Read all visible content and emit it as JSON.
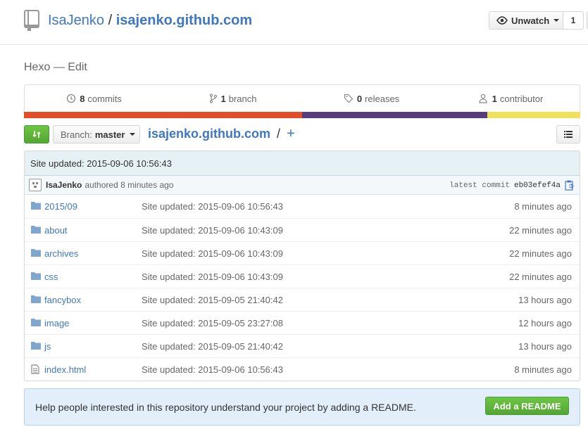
{
  "header": {
    "owner": "IsaJenko",
    "separator": "/",
    "repo": "isajenko.github.com",
    "watch_label": "Unwatch",
    "watch_count": "1"
  },
  "description": {
    "text": "Hexo",
    "dash": "—",
    "edit_label": "Edit"
  },
  "summary": {
    "commits": {
      "count": "8",
      "label": "commits"
    },
    "branches": {
      "count": "1",
      "label": "branch"
    },
    "releases": {
      "count": "0",
      "label": "releases"
    },
    "contributors": {
      "count": "1",
      "label": "contributor"
    }
  },
  "language_bar": [
    {
      "color": "#e34c26",
      "share": 0.5
    },
    {
      "color": "#563d7c",
      "share": 0.333
    },
    {
      "color": "#f1e05a",
      "share": 0.167
    }
  ],
  "file_nav": {
    "branch_prefix": "Branch:",
    "branch_name": "master",
    "breadcrumb_root": "isajenko.github.com",
    "breadcrumb_slash": "/",
    "add_symbol": "+"
  },
  "commit": {
    "message": "Site updated: 2015-09-06 10:56:43",
    "author": "IsaJenko",
    "authored_text": "authored 8 minutes ago",
    "latest_label": "latest commit",
    "sha": "eb03efef4a"
  },
  "files": [
    {
      "name": "2015/09",
      "type": "folder",
      "message": "Site updated: 2015-09-06 10:56:43",
      "age": "8 minutes ago"
    },
    {
      "name": "about",
      "type": "folder",
      "message": "Site updated: 2015-09-06 10:43:09",
      "age": "22 minutes ago"
    },
    {
      "name": "archives",
      "type": "folder",
      "message": "Site updated: 2015-09-06 10:43:09",
      "age": "22 minutes ago"
    },
    {
      "name": "css",
      "type": "folder",
      "message": "Site updated: 2015-09-06 10:43:09",
      "age": "22 minutes ago"
    },
    {
      "name": "fancybox",
      "type": "folder",
      "message": "Site updated: 2015-09-05 21:40:42",
      "age": "13 hours ago"
    },
    {
      "name": "image",
      "type": "folder",
      "message": "Site updated: 2015-09-05 23:27:08",
      "age": "12 hours ago"
    },
    {
      "name": "js",
      "type": "folder",
      "message": "Site updated: 2015-09-05 21:40:42",
      "age": "13 hours ago"
    },
    {
      "name": "index.html",
      "type": "file",
      "message": "Site updated: 2015-09-06 10:56:43",
      "age": "8 minutes ago"
    }
  ],
  "readme_prompt": {
    "text": "Help people interested in this repository understand your project by adding a README.",
    "button_label": "Add a README"
  },
  "colors": {
    "link": "#4078c0",
    "green": "#55a532",
    "folder": "#80a6cd"
  }
}
